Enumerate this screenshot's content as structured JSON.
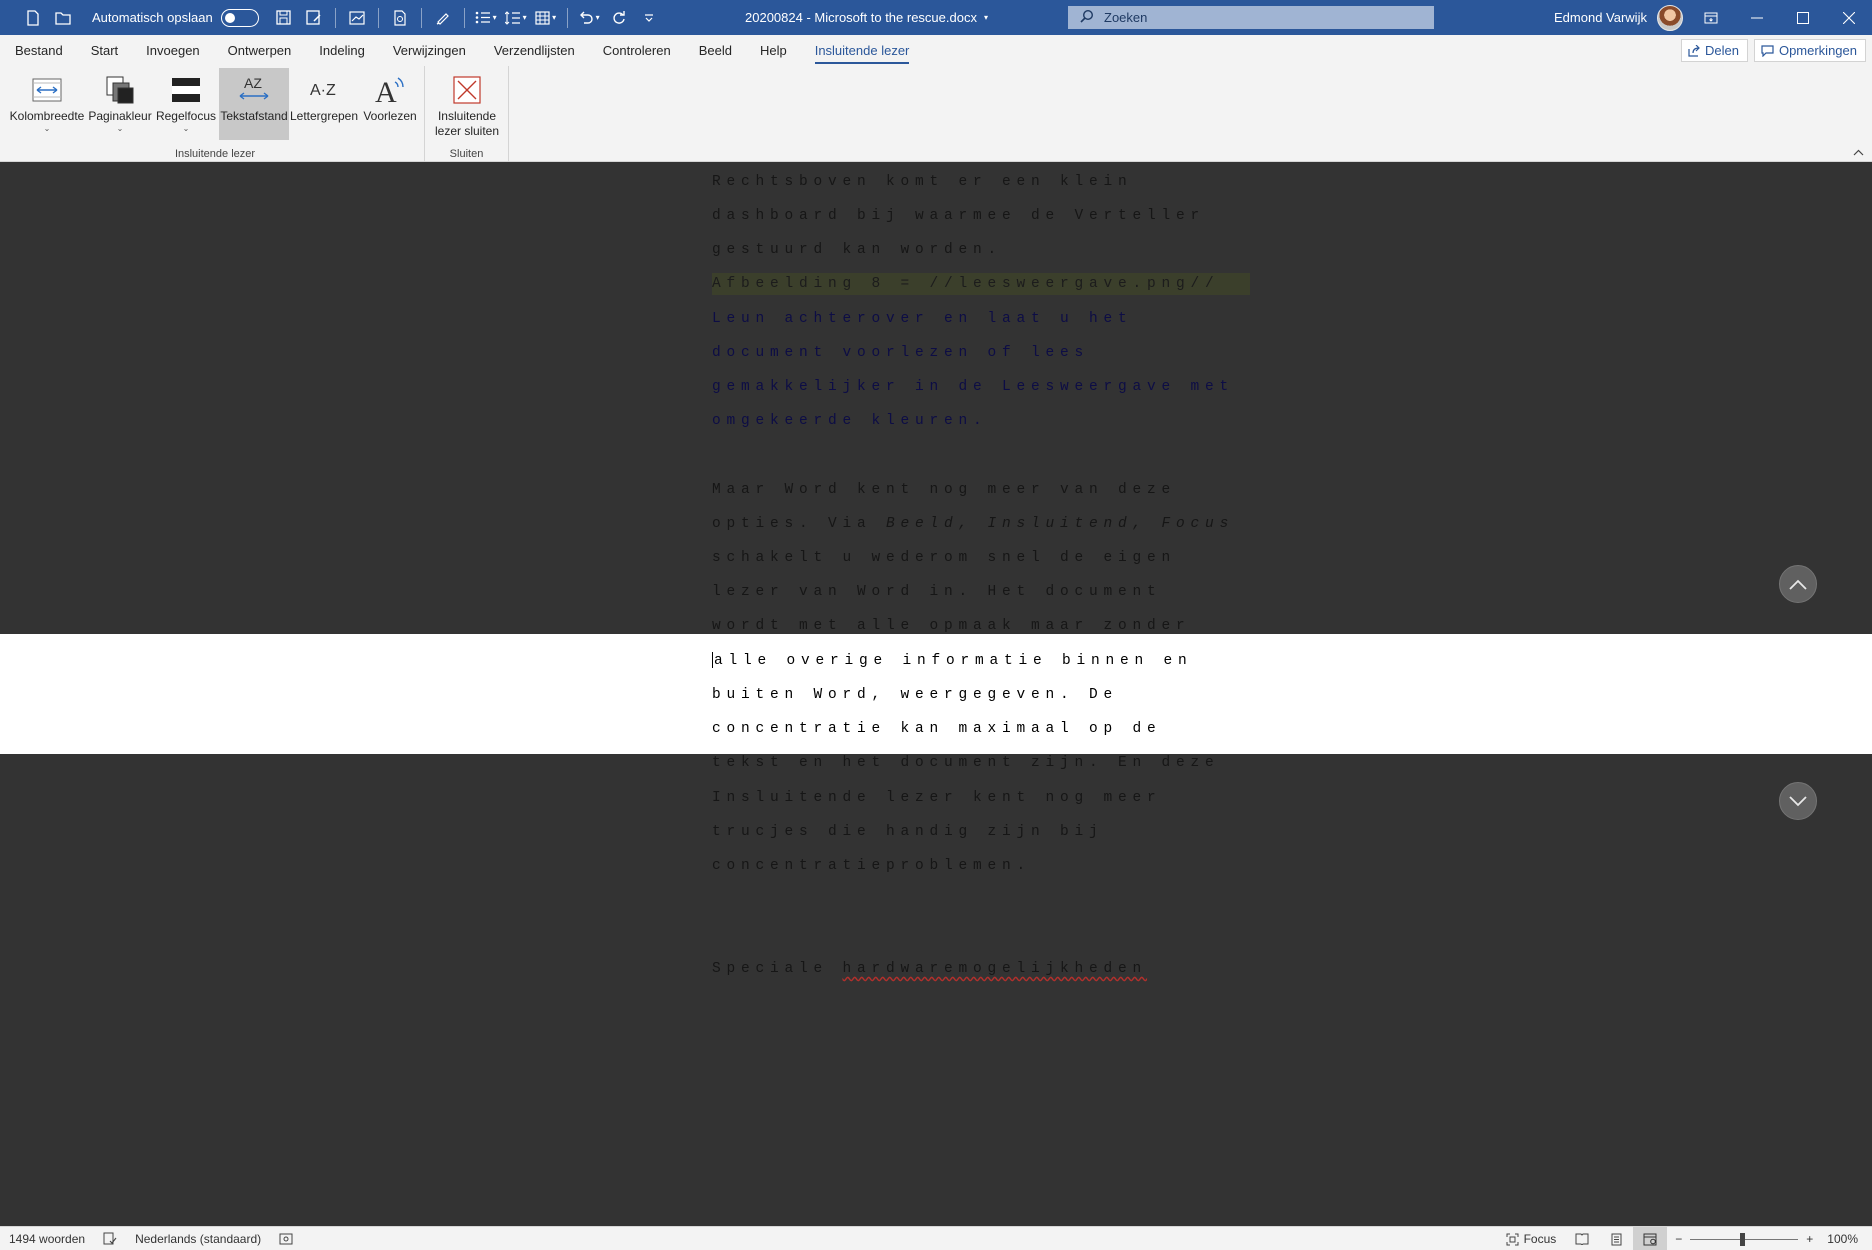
{
  "titlebar": {
    "autosave_label": "Automatisch opslaan",
    "doc_title": "20200824 - Microsoft to the rescue.docx",
    "search_placeholder": "Zoeken",
    "user_name": "Edmond Varwijk"
  },
  "menu": {
    "tabs": [
      "Bestand",
      "Start",
      "Invoegen",
      "Ontwerpen",
      "Indeling",
      "Verwijzingen",
      "Verzendlijsten",
      "Controleren",
      "Beeld",
      "Help",
      "Insluitende lezer"
    ],
    "active_tab": "Insluitende lezer",
    "share_label": "Delen",
    "comments_label": "Opmerkingen"
  },
  "ribbon": {
    "group1": {
      "label": "Insluitende lezer",
      "buttons": [
        "Kolombreedte",
        "Paginakleur",
        "Regelfocus",
        "Tekstafstand",
        "Lettergrepen",
        "Voorlezen"
      ],
      "active_button": "Tekstafstand"
    },
    "group2": {
      "label": "Sluiten",
      "close_line1": "Insluitende",
      "close_line2": "lezer sluiten"
    }
  },
  "document": {
    "lines": [
      "Rechtsboven komt er een klein",
      "dashboard bij waarmee de Verteller",
      "gestuurd kan worden.",
      "Afbeelding 8 = //leesweergave.png//",
      "Leun achterover en laat u het",
      "document voorlezen of lees",
      "gemakkelijker in de Leesweergave met",
      "omgekeerde kleuren.",
      "Maar Word kent nog meer van deze",
      "opties. Via ",
      "Beeld, Insluitend, Focus",
      "schakelt u wederom snel de eigen",
      "lezer van Word in. Het document",
      "wordt met alle opmaak maar zonder",
      "alle overige informatie binnen en",
      "buiten Word, weergegeven. De",
      "concentratie kan maximaal op de",
      "tekst en het document zijn. En deze",
      "Insluitende lezer kent nog meer",
      "trucjes die handig zijn bij",
      "concentratieproblemen.",
      "Speciale ",
      "hardwaremogelijkheden"
    ]
  },
  "statusbar": {
    "word_count": "1494 woorden",
    "language": "Nederlands (standaard)",
    "focus_label": "Focus",
    "zoom": "100%"
  },
  "colors": {
    "title_bar": "#2b579a",
    "ribbon_bg": "#f3f3f3",
    "doc_bg": "#333333",
    "focus_band": "#ffffff",
    "link_blue": "#0d0d45",
    "highlight": "#3b3f2b"
  }
}
